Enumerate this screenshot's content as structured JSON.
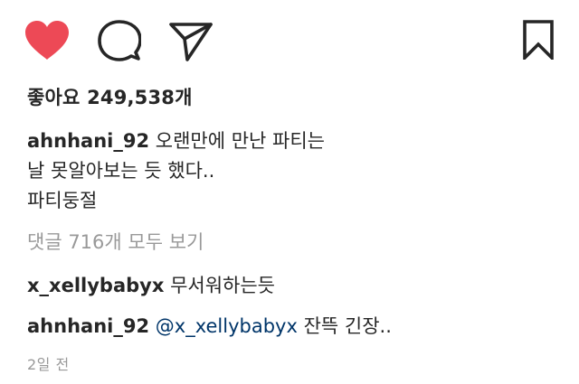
{
  "actions": {
    "like_icon": "heart-icon",
    "like_color": "#ed4956",
    "comment_icon": "comment-icon",
    "share_icon": "paper-plane-icon",
    "save_icon": "bookmark-icon"
  },
  "likes": {
    "text": "좋아요 249,538개"
  },
  "caption": {
    "username": "ahnhani_92",
    "line1": "오랜만에 만난 파티는",
    "line2": "날 못알아보는 듯 했다..",
    "line3": "파티둥절"
  },
  "view_comments": {
    "text": "댓글 716개 모두 보기"
  },
  "comments": [
    {
      "username": "x_xellybabyx",
      "mention": "",
      "text": "무서워하는듯"
    },
    {
      "username": "ahnhani_92",
      "mention": "@x_xellybabyx",
      "text": "잔뜩 긴장.."
    }
  ],
  "timestamp": {
    "text": "2일 전"
  }
}
